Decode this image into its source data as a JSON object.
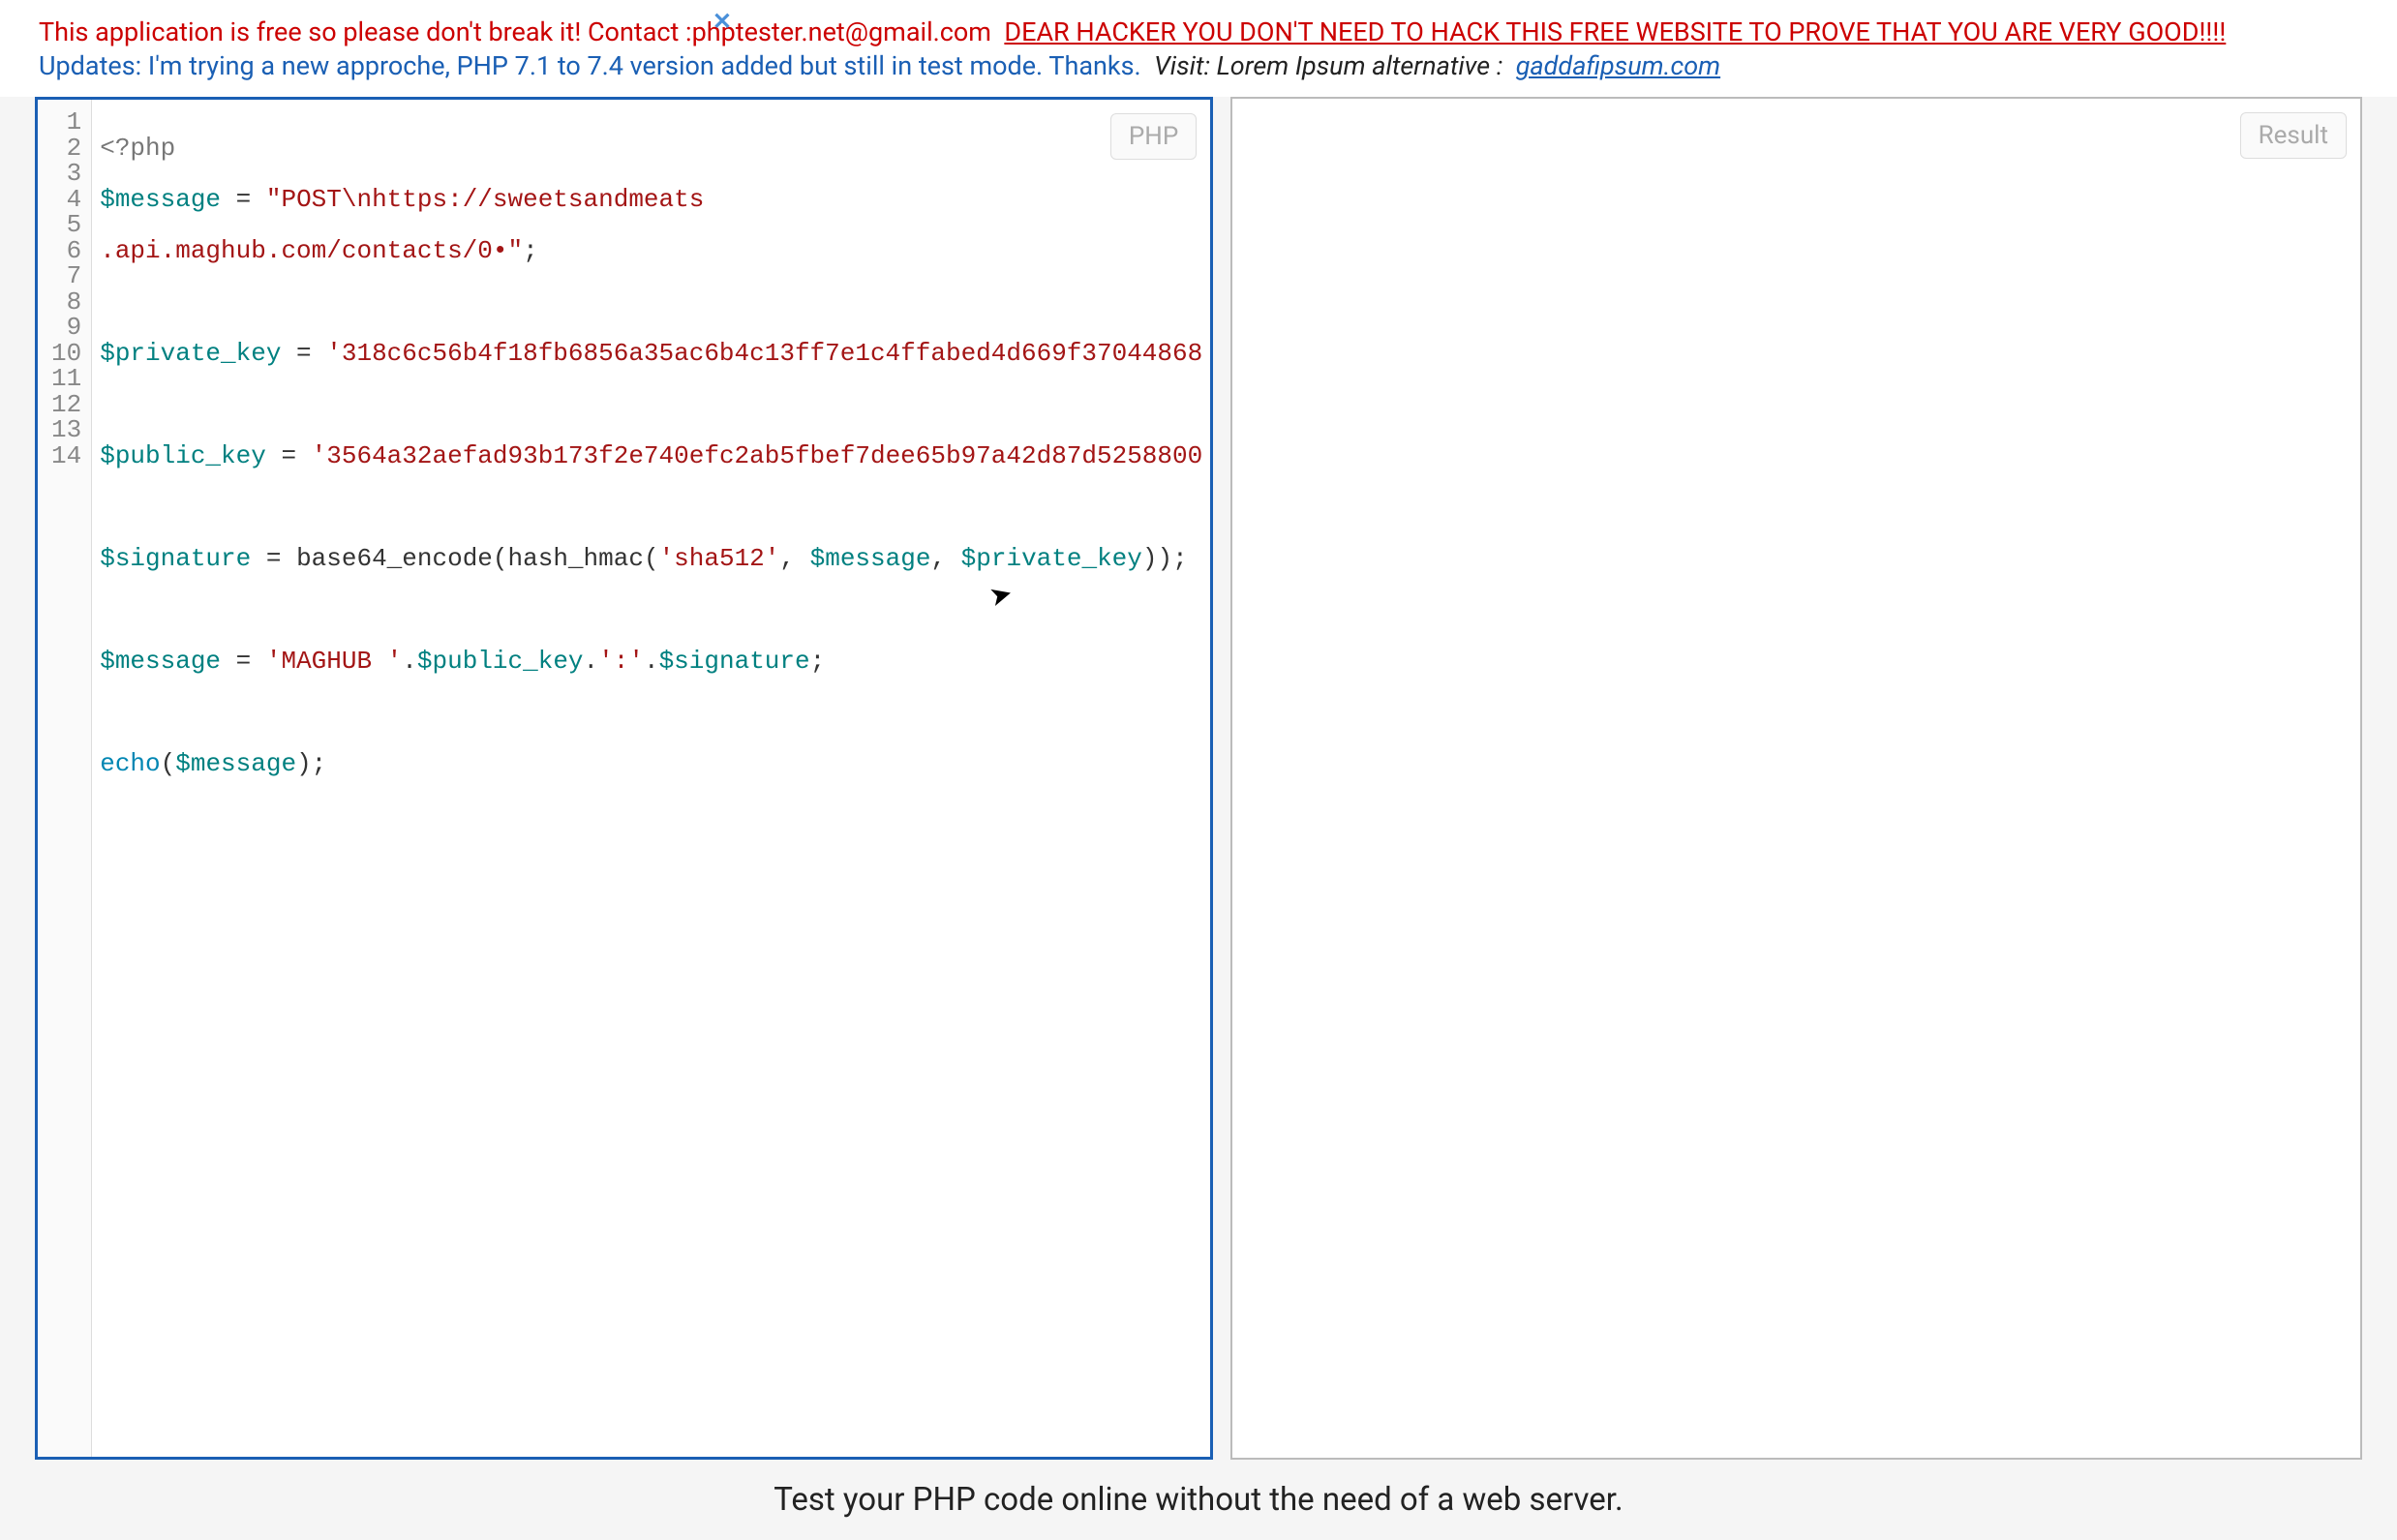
{
  "topbar": {
    "close": "✕"
  },
  "banner": {
    "text1": "This application is free so please don't break it! Contact :",
    "email": "phptester.net@gmail.com",
    "hacker": "DEAR HACKER YOU DON'T NEED TO HACK THIS FREE WEBSITE TO PROVE THAT YOU ARE VERY GOOD!!!!",
    "updates": "Updates: I'm trying a new approche, PHP 7.1 to 7.4 version added but still in test mode. Thanks.",
    "visit": "Visit: Lorem Ipsum alternative :",
    "link": "gaddafipsum.com"
  },
  "editor": {
    "label_left": "PHP",
    "label_right": "Result",
    "line_count": 14,
    "code": {
      "l1": {
        "open": "<?php"
      },
      "l2": {
        "var": "$message",
        "eq": " = ",
        "str": "\"POST\\nhttps://sweetsandmeats"
      },
      "l3": {
        "str": ".api.maghub.com/contacts/0•\"",
        "semi": ";"
      },
      "l5": {
        "var": "$private_key",
        "eq": " = ",
        "str": "'318c6c56b4f18fb6856a35ac6b4c13ff7e1c4ffabed4d669f37044868"
      },
      "l7": {
        "var": "$public_key",
        "eq": " = ",
        "str": "'3564a32aefad93b173f2e740efc2ab5fbef7dee65b97a42d87d5258800"
      },
      "l9": {
        "var": "$signature",
        "eq": " = ",
        "fn": "base64_encode",
        "p1": "(",
        "fn2": "hash_hmac",
        "p2": "(",
        "str": "'sha512'",
        "c1": ", ",
        "var2": "$message",
        "c2": ", ",
        "var3": "$private_key",
        "p3": "));"
      },
      "l11": {
        "var": "$message",
        "eq": " = ",
        "str1": "'MAGHUB '",
        "dot1": ".",
        "var2": "$public_key",
        "dot2": ".",
        "str2": "':'",
        "dot3": ".",
        "var3": "$signature",
        "semi": ";"
      },
      "l13": {
        "fn": "echo",
        "p1": "(",
        "var": "$message",
        "p2": ");"
      }
    }
  },
  "footer": {
    "text": "Test your PHP code online without the need of a web server."
  }
}
